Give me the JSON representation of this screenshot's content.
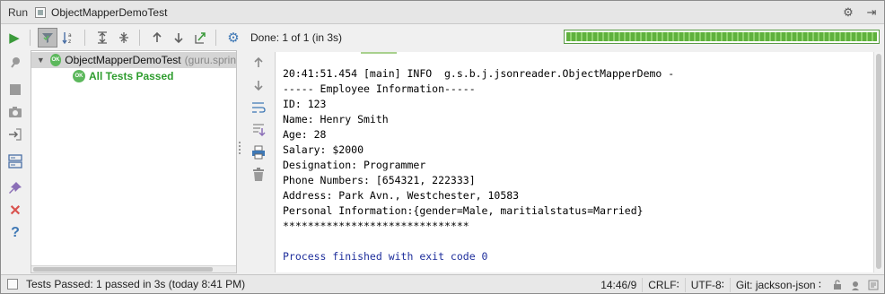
{
  "titlebar": {
    "run_label": "Run",
    "tab_title": "ObjectMapperDemoTest"
  },
  "toolbar": {
    "status": "Done: 1 of 1 (in 3s)",
    "progress_fraction": 1.0
  },
  "tree": {
    "root": {
      "name": "ObjectMapperDemoTest",
      "package": "(guru.sprin"
    },
    "child": {
      "label": "All Tests Passed"
    },
    "badge": "OK"
  },
  "console": {
    "lines": [
      "20:41:51.454 [main] INFO  g.s.b.j.jsonreader.ObjectMapperDemo -",
      "----- Employee Information-----",
      "ID: 123",
      "Name: Henry Smith",
      "Age: 28",
      "Salary: $2000",
      "Designation: Programmer",
      "Phone Numbers: [654321, 222333]",
      "Address: Park Avn., Westchester, 10583",
      "Personal Information:{gender=Male, maritialstatus=Married}",
      "******************************",
      "",
      "Process finished with exit code 0"
    ]
  },
  "statusbar": {
    "message": "Tests Passed: 1 passed in 3s (today 8:41 PM)",
    "position": "14:46/9",
    "line_sep": "CRLF∶",
    "encoding": "UTF-8∶",
    "vcs": "Git: jackson-json ∶"
  },
  "colors": {
    "progress": "#5fb13d",
    "passed": "#2f9d2f",
    "exit_text": "#1f2f9c"
  }
}
